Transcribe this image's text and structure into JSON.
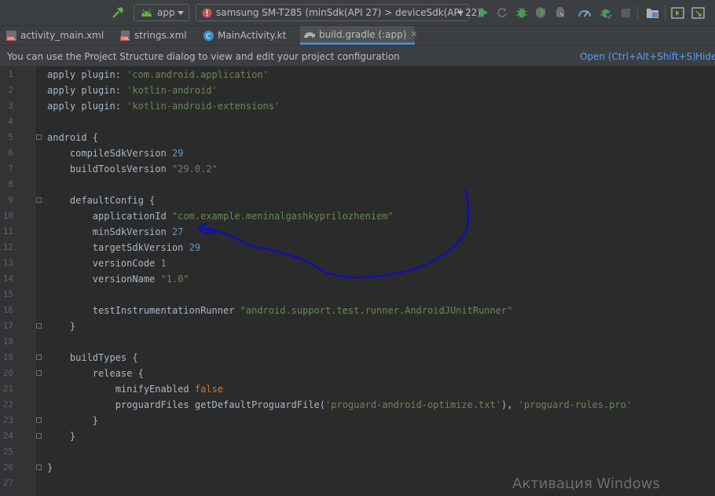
{
  "toolbar": {
    "config_name": "app",
    "device_label": "samsung SM-T285 (minSdk(API 27) > deviceSdk(API 22))",
    "icons": [
      "hammer-icon",
      "android-icon",
      "error-icon",
      "run-icon",
      "apply-changes-icon",
      "debug-icon",
      "coverage-icon",
      "profile-icon",
      "attach-debugger-icon",
      "stop-icon",
      "project-structure-icon",
      "avd-manager-icon",
      "sdk-manager-icon"
    ]
  },
  "tabs": [
    {
      "label": "activity_main.xml",
      "icon": "xml-layout-icon"
    },
    {
      "label": "strings.xml",
      "icon": "xml-values-icon"
    },
    {
      "label": "MainActivity.kt",
      "icon": "kotlin-class-icon"
    },
    {
      "label": "build.gradle (:app)",
      "icon": "gradle-icon",
      "close": "✕"
    }
  ],
  "notification": {
    "text": "You can use the Project Structure dialog to view and edit your project configuration",
    "open_link": "Open (Ctrl+Alt+Shift+S)",
    "hide_link": "Hide"
  },
  "editor": {
    "lines": [
      {
        "n": "1",
        "tokens": [
          {
            "t": "apply plugin: ",
            "c": ""
          },
          {
            "t": "'com.android.application'",
            "c": "str"
          }
        ]
      },
      {
        "n": "2",
        "tokens": [
          {
            "t": "apply plugin: ",
            "c": ""
          },
          {
            "t": "'kotlin-android'",
            "c": "str"
          }
        ]
      },
      {
        "n": "3",
        "tokens": [
          {
            "t": "apply plugin: ",
            "c": ""
          },
          {
            "t": "'kotlin-android-extensions'",
            "c": "str"
          }
        ]
      },
      {
        "n": "4",
        "tokens": []
      },
      {
        "n": "5",
        "tokens": [
          {
            "t": "android {",
            "c": ""
          }
        ]
      },
      {
        "n": "6",
        "tokens": [
          {
            "t": "    compileSdkVersion ",
            "c": ""
          },
          {
            "t": "29",
            "c": "num"
          }
        ]
      },
      {
        "n": "7",
        "tokens": [
          {
            "t": "    buildToolsVersion ",
            "c": ""
          },
          {
            "t": "\"29.0.2\"",
            "c": "str"
          }
        ]
      },
      {
        "n": "8",
        "tokens": []
      },
      {
        "n": "9",
        "tokens": [
          {
            "t": "    defaultConfig {",
            "c": ""
          }
        ]
      },
      {
        "n": "10",
        "tokens": [
          {
            "t": "        applicationId ",
            "c": ""
          },
          {
            "t": "\"com.example.meninalgashkyprilozheniem\"",
            "c": "str"
          }
        ]
      },
      {
        "n": "11",
        "tokens": [
          {
            "t": "        minSdkVersion ",
            "c": ""
          },
          {
            "t": "27",
            "c": "num"
          }
        ]
      },
      {
        "n": "12",
        "tokens": [
          {
            "t": "        targetSdkVersion ",
            "c": ""
          },
          {
            "t": "29",
            "c": "num"
          }
        ]
      },
      {
        "n": "13",
        "tokens": [
          {
            "t": "        versionCode ",
            "c": ""
          },
          {
            "t": "1",
            "c": "num"
          }
        ]
      },
      {
        "n": "14",
        "tokens": [
          {
            "t": "        versionName ",
            "c": ""
          },
          {
            "t": "\"1.0\"",
            "c": "str"
          }
        ]
      },
      {
        "n": "15",
        "tokens": []
      },
      {
        "n": "16",
        "tokens": [
          {
            "t": "        testInstrumentationRunner ",
            "c": ""
          },
          {
            "t": "\"android.support.test.runner.AndroidJUnitRunner\"",
            "c": "str"
          }
        ]
      },
      {
        "n": "17",
        "tokens": [
          {
            "t": "    }",
            "c": ""
          }
        ]
      },
      {
        "n": "18",
        "tokens": []
      },
      {
        "n": "19",
        "tokens": [
          {
            "t": "    buildTypes {",
            "c": ""
          }
        ]
      },
      {
        "n": "20",
        "tokens": [
          {
            "t": "        release {",
            "c": ""
          }
        ]
      },
      {
        "n": "21",
        "tokens": [
          {
            "t": "            minifyEnabled ",
            "c": ""
          },
          {
            "t": "false",
            "c": "kw"
          }
        ]
      },
      {
        "n": "22",
        "tokens": [
          {
            "t": "            proguardFiles getDefaultProguardFile(",
            "c": ""
          },
          {
            "t": "'proguard-android-optimize.txt'",
            "c": "str"
          },
          {
            "t": "), ",
            "c": ""
          },
          {
            "t": "'proguard-rules.pro'",
            "c": "str"
          }
        ]
      },
      {
        "n": "23",
        "tokens": [
          {
            "t": "        }",
            "c": ""
          }
        ]
      },
      {
        "n": "24",
        "tokens": [
          {
            "t": "    }",
            "c": ""
          }
        ]
      },
      {
        "n": "25",
        "tokens": []
      },
      {
        "n": "26",
        "tokens": [
          {
            "t": "}",
            "c": ""
          }
        ]
      },
      {
        "n": "27",
        "tokens": []
      }
    ]
  },
  "annotation": {
    "color": "#0a0ad6",
    "shape": "hand-drawn arrow pointing to minSdkVersion 27"
  },
  "watermark": "Активация Windows",
  "colors": {
    "background": "#2b2b2b",
    "toolbar": "#3c3f41",
    "accent": "#4a88c7",
    "link": "#589df6",
    "string": "#6a8759",
    "number": "#6897bb",
    "keyword": "#cc7832",
    "text": "#a9b7c6"
  }
}
